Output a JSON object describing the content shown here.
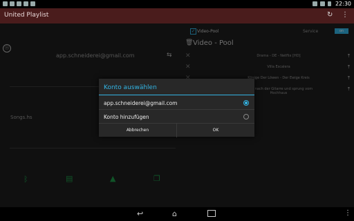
{
  "statusbar": {
    "time": "22:30"
  },
  "app": {
    "title": "United Playlist"
  },
  "left": {
    "account_email": "app.schneiderei@gmail.com",
    "songs_label": "Songs.hs"
  },
  "right": {
    "video_pool_checkbox_label": "Video-Pool",
    "service_label": "Service",
    "service_toggle_value": "on",
    "pool_title": "Video - Pool",
    "pool_items": [
      {
        "title": "Drama - DE - Netflix [HD]"
      },
      {
        "title": "Villa Escalera"
      },
      {
        "title": "Könige Der Löwen - Der Ewige Kreis"
      },
      {
        "title": "Bezzi nach der Gitarre und sprung vom Hochhaus"
      }
    ]
  },
  "dialog": {
    "title": "Konto auswählen",
    "options": [
      {
        "label": "app.schneiderei@gmail.com",
        "selected": true
      },
      {
        "label": "Konto hinzufügen",
        "selected": false
      }
    ],
    "cancel_label": "Abbrechen",
    "ok_label": "OK"
  },
  "colors": {
    "accent": "#33b5e5",
    "actionbar": "#4a1c1c",
    "icon_green": "#1e9a4a"
  }
}
